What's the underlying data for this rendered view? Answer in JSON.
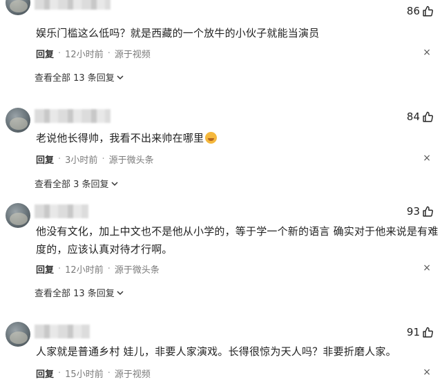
{
  "comments": [
    {
      "likes": "86",
      "text": "娱乐门槛这么低吗？就是西藏的一个放牛的小伙子就能当演员",
      "reply_label": "回复",
      "time": "12小时前",
      "source": "源于视频",
      "close": "×",
      "view_all": "查看全部 13 条回复"
    },
    {
      "likes": "84",
      "text": "老说他长得帅，我看不出来帅在哪里",
      "reply_label": "回复",
      "time": "3小时前",
      "source": "源于微头条",
      "close": "×",
      "view_all": "查看全部 3 条回复"
    },
    {
      "likes": "93",
      "text_line1": "他没有文化，加上中文也不是他从小学的，等于学一个新的语言 确实对于他来说是有难",
      "text_line2": "度的，应该认真对待才行啊。",
      "reply_label": "回复",
      "time": "12小时前",
      "source": "源于微头条",
      "close": "×",
      "view_all": "查看全部 13 条回复"
    },
    {
      "likes": "91",
      "text": "人家就是普通乡村 娃儿，非要人家演戏。长得很惊为天人吗？非要折磨人家。",
      "reply_label": "回复",
      "time": "15小时前",
      "source": "源于视频",
      "close": "×"
    }
  ],
  "icons": {
    "like": "thumbs-up-icon",
    "expand": "chevron-down-icon",
    "close": "close-icon",
    "emoji": "laughing-emoji-icon"
  }
}
